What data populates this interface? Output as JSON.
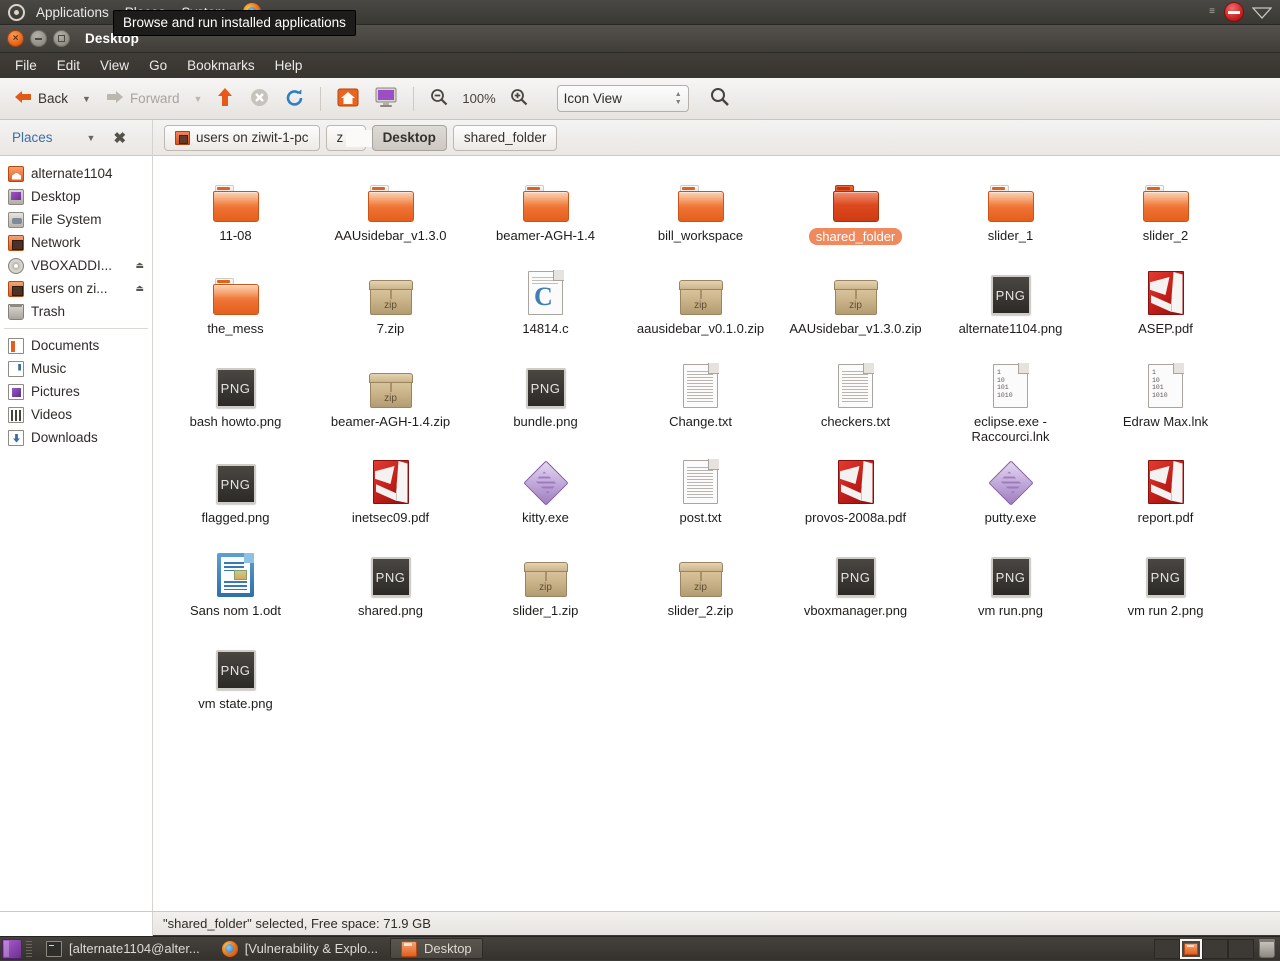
{
  "panel": {
    "menus": [
      "Applications",
      "Places",
      "System"
    ],
    "logo_icon": "ubuntu-logo-icon",
    "firefox_icon": "firefox-icon",
    "update_icon": "update-blocked-icon",
    "network_icon": "wifi-icon",
    "tooltip": "Browse and run installed applications"
  },
  "window": {
    "title": "Desktop",
    "close_label": "x",
    "menubar": [
      "File",
      "Edit",
      "View",
      "Go",
      "Bookmarks",
      "Help"
    ]
  },
  "toolbar": {
    "back_label": "Back",
    "forward_label": "Forward",
    "up_icon": "arrow-up-icon",
    "stop_icon": "stop-icon",
    "reload_icon": "reload-icon",
    "home_icon": "home-icon",
    "computer_icon": "computer-icon",
    "zoom_out_icon": "zoom-out-icon",
    "zoom_level": "100%",
    "zoom_in_icon": "zoom-in-icon",
    "view_mode": "Icon View",
    "search_icon": "search-icon"
  },
  "places": {
    "header": "Places",
    "caret_icon": "chevron-down-icon",
    "close_icon": "close-icon",
    "items": [
      {
        "label": "alternate1104",
        "icon": "home-icon",
        "eject": false
      },
      {
        "label": "Desktop",
        "icon": "desktop-icon",
        "eject": false
      },
      {
        "label": "File System",
        "icon": "harddisk-icon",
        "eject": false
      },
      {
        "label": "Network",
        "icon": "network-folder-icon",
        "eject": false
      },
      {
        "label": "VBOXADDI...",
        "icon": "cdrom-icon",
        "eject": true
      },
      {
        "label": "users on zi...",
        "icon": "network-folder-icon",
        "eject": true
      },
      {
        "label": "Trash",
        "icon": "trash-icon",
        "eject": false
      }
    ],
    "bookmarks": [
      {
        "label": "Documents",
        "icon": "documents-icon"
      },
      {
        "label": "Music",
        "icon": "music-icon"
      },
      {
        "label": "Pictures",
        "icon": "pictures-icon"
      },
      {
        "label": "Videos",
        "icon": "videos-icon"
      },
      {
        "label": "Downloads",
        "icon": "downloads-icon"
      }
    ]
  },
  "breadcrumbs": [
    {
      "label": "users on ziwit-1-pc",
      "icon": "network-folder-icon",
      "current": false,
      "redacted": false
    },
    {
      "label": "z        1",
      "icon": "",
      "current": false,
      "redacted": true
    },
    {
      "label": "Desktop",
      "icon": "",
      "current": true,
      "redacted": false
    },
    {
      "label": "shared_folder",
      "icon": "",
      "current": false,
      "redacted": false
    }
  ],
  "files": [
    {
      "name": "11-08",
      "type": "folder",
      "selected": false
    },
    {
      "name": "AAUsidebar_v1.3.0",
      "type": "folder",
      "selected": false
    },
    {
      "name": "beamer-AGH-1.4",
      "type": "folder",
      "selected": false
    },
    {
      "name": "bill_workspace",
      "type": "folder",
      "selected": false
    },
    {
      "name": "shared_folder",
      "type": "folder",
      "selected": true
    },
    {
      "name": "slider_1",
      "type": "folder",
      "selected": false
    },
    {
      "name": "slider_2",
      "type": "folder",
      "selected": false
    },
    {
      "name": "the_mess",
      "type": "folder",
      "selected": false
    },
    {
      "name": "7.zip",
      "type": "zip",
      "selected": false
    },
    {
      "name": "14814.c",
      "type": "csource",
      "selected": false
    },
    {
      "name": "aausidebar_v0.1.0.zip",
      "type": "zip",
      "selected": false
    },
    {
      "name": "AAUsidebar_v1.3.0.zip",
      "type": "zip",
      "selected": false
    },
    {
      "name": "alternate1104.png",
      "type": "png",
      "selected": false
    },
    {
      "name": "ASEP.pdf",
      "type": "pdf",
      "selected": false
    },
    {
      "name": "bash howto.png",
      "type": "png",
      "selected": false
    },
    {
      "name": "beamer-AGH-1.4.zip",
      "type": "zip",
      "selected": false
    },
    {
      "name": "bundle.png",
      "type": "png",
      "selected": false
    },
    {
      "name": "Change.txt",
      "type": "text",
      "selected": false
    },
    {
      "name": "checkers.txt",
      "type": "text",
      "selected": false
    },
    {
      "name": "eclipse.exe - Raccourci.lnk",
      "type": "binary",
      "selected": false
    },
    {
      "name": "Edraw Max.lnk",
      "type": "binary",
      "selected": false
    },
    {
      "name": "flagged.png",
      "type": "png",
      "selected": false
    },
    {
      "name": "inetsec09.pdf",
      "type": "pdf",
      "selected": false
    },
    {
      "name": "kitty.exe",
      "type": "exe",
      "selected": false
    },
    {
      "name": "post.txt",
      "type": "text",
      "selected": false
    },
    {
      "name": "provos-2008a.pdf",
      "type": "pdf",
      "selected": false
    },
    {
      "name": "putty.exe",
      "type": "exe",
      "selected": false
    },
    {
      "name": "report.pdf",
      "type": "pdf",
      "selected": false
    },
    {
      "name": "Sans nom 1.odt",
      "type": "odt",
      "selected": false
    },
    {
      "name": "shared.png",
      "type": "png",
      "selected": false
    },
    {
      "name": "slider_1.zip",
      "type": "zip",
      "selected": false
    },
    {
      "name": "slider_2.zip",
      "type": "zip",
      "selected": false
    },
    {
      "name": "vboxmanager.png",
      "type": "png",
      "selected": false
    },
    {
      "name": "vm run.png",
      "type": "png",
      "selected": false
    },
    {
      "name": "vm run 2.png",
      "type": "png",
      "selected": false
    },
    {
      "name": "vm state.png",
      "type": "png",
      "selected": false
    }
  ],
  "statusbar": {
    "text": "\"shared_folder\" selected, Free space: 71.9 GB"
  },
  "taskbar": {
    "show_desktop_icon": "show-desktop-icon",
    "windows": [
      {
        "label": "[alternate1104@alter...",
        "icon": "terminal-icon",
        "active": false
      },
      {
        "label": "[Vulnerability & Explo...",
        "icon": "firefox-icon",
        "active": false
      },
      {
        "label": "Desktop",
        "icon": "folder-icon",
        "active": true
      }
    ],
    "workspace_icon": "workspace-folder-icon",
    "trash_icon": "trash-icon"
  },
  "zip_label": "zip",
  "png_label": "PNG",
  "binary_lines": [
    "1",
    "10",
    "101",
    "1010"
  ],
  "colors": {
    "selection": "#f08a5d",
    "panel_bg": "#3a3833",
    "folder_orange": "#e45f1d"
  }
}
